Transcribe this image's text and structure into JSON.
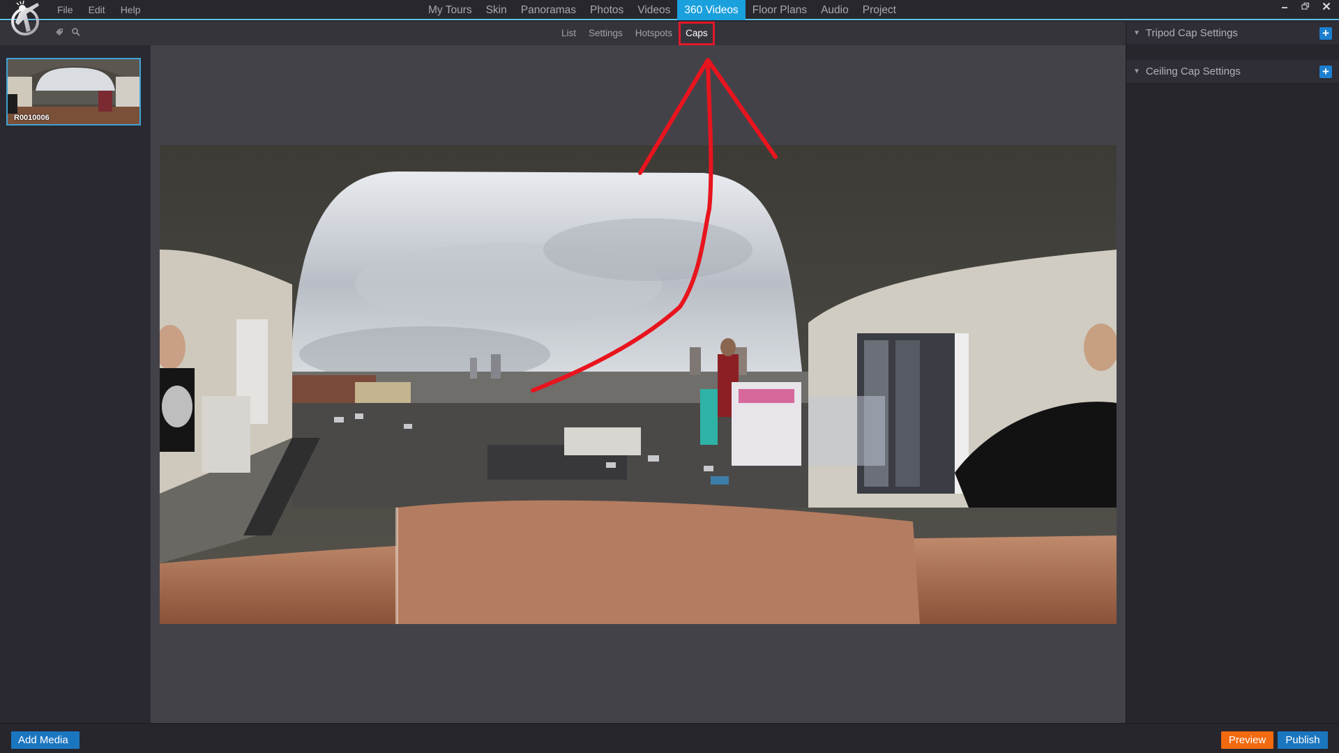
{
  "menubar": {
    "menu_items": [
      "File",
      "Edit",
      "Help"
    ],
    "nav_tabs": [
      {
        "label": "My Tours",
        "active": false
      },
      {
        "label": "Skin",
        "active": false
      },
      {
        "label": "Panoramas",
        "active": false
      },
      {
        "label": "Photos",
        "active": false
      },
      {
        "label": "Videos",
        "active": false
      },
      {
        "label": "360 Videos",
        "active": true
      },
      {
        "label": "Floor Plans",
        "active": false
      },
      {
        "label": "Audio",
        "active": false
      },
      {
        "label": "Project",
        "active": false
      }
    ],
    "window_controls": {
      "minimize": "minimize-icon",
      "restore": "restore-icon",
      "close": "close-icon"
    }
  },
  "subbar": {
    "tools": [
      "tag-icon",
      "search-icon"
    ],
    "tabs": [
      {
        "label": "List",
        "active": false
      },
      {
        "label": "Settings",
        "active": false
      },
      {
        "label": "Hotspots",
        "active": false
      },
      {
        "label": "Caps",
        "active": true
      }
    ]
  },
  "left_panel": {
    "media": [
      {
        "label": "R0010006",
        "selected": true
      }
    ]
  },
  "right_panel": {
    "sections": [
      {
        "title": "Tripod Cap Settings",
        "expanded": true
      },
      {
        "title": "Ceiling Cap Settings",
        "expanded": true
      }
    ]
  },
  "bottom_bar": {
    "add_media": "Add Media",
    "preview": "Preview",
    "publish": "Publish"
  },
  "colors": {
    "accent": "#1aa0dc",
    "button_blue": "#1b76c0",
    "preview_orange": "#f26a0f",
    "annotation_red": "#e0182a"
  }
}
